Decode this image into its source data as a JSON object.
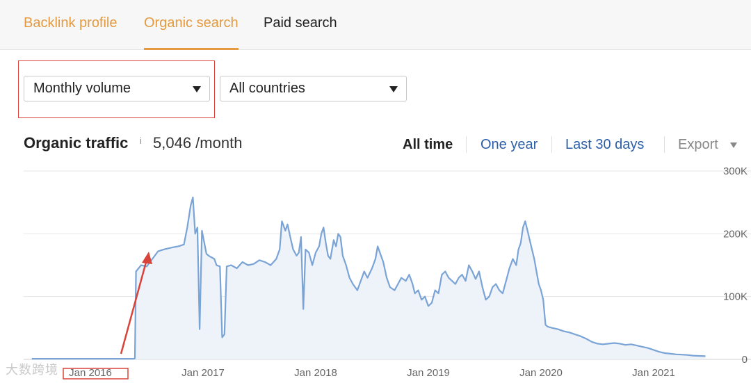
{
  "tabs": [
    {
      "label": "Backlink profile"
    },
    {
      "label": "Organic search"
    },
    {
      "label": "Paid search"
    }
  ],
  "filters": {
    "volume": "Monthly volume",
    "country": "All countries"
  },
  "traffic": {
    "title": "Organic traffic",
    "info": "i",
    "value": "5,046 /month"
  },
  "ranges": {
    "all": "All time",
    "year": "One year",
    "last30": "Last 30 days",
    "export": "Export"
  },
  "watermark": "大数跨境",
  "colors": {
    "accent": "#e39a40",
    "link": "#2c5ea8",
    "line": "#7aa3d6",
    "fill": "#eef3fa",
    "annotation": "#d9443a"
  },
  "chart_data": {
    "type": "area",
    "ylim": [
      0,
      300000
    ],
    "y_ticks": [
      {
        "value": 300000,
        "label": "300K"
      },
      {
        "value": 200000,
        "label": "200K"
      },
      {
        "value": 100000,
        "label": "100K"
      },
      {
        "value": 0,
        "label": "0"
      }
    ],
    "x_ticks": [
      {
        "value": 2016.0,
        "label": "Jan 2016"
      },
      {
        "value": 2017.0,
        "label": "Jan 2017"
      },
      {
        "value": 2018.0,
        "label": "Jan 2018"
      },
      {
        "value": 2019.0,
        "label": "Jan 2019"
      },
      {
        "value": 2020.0,
        "label": "Jan 2020"
      },
      {
        "value": 2021.0,
        "label": "Jan 2021"
      }
    ],
    "series": [
      {
        "points": [
          [
            2015.48,
            1000
          ],
          [
            2016.0,
            1000
          ],
          [
            2016.38,
            1000
          ],
          [
            2016.395,
            1500
          ],
          [
            2016.405,
            140000
          ],
          [
            2016.45,
            150000
          ],
          [
            2016.5,
            148000
          ],
          [
            2016.55,
            160000
          ],
          [
            2016.6,
            172000
          ],
          [
            2016.65,
            175000
          ],
          [
            2016.72,
            178000
          ],
          [
            2016.78,
            180000
          ],
          [
            2016.83,
            183000
          ],
          [
            2016.86,
            210000
          ],
          [
            2016.89,
            245000
          ],
          [
            2016.91,
            258000
          ],
          [
            2016.93,
            200000
          ],
          [
            2016.95,
            210000
          ],
          [
            2016.97,
            48000
          ],
          [
            2016.99,
            205000
          ],
          [
            2017.03,
            168000
          ],
          [
            2017.05,
            165000
          ],
          [
            2017.1,
            160000
          ],
          [
            2017.12,
            150000
          ],
          [
            2017.15,
            148000
          ],
          [
            2017.17,
            35000
          ],
          [
            2017.19,
            40000
          ],
          [
            2017.21,
            148000
          ],
          [
            2017.25,
            150000
          ],
          [
            2017.3,
            145000
          ],
          [
            2017.35,
            155000
          ],
          [
            2017.4,
            150000
          ],
          [
            2017.45,
            152000
          ],
          [
            2017.5,
            158000
          ],
          [
            2017.55,
            155000
          ],
          [
            2017.6,
            150000
          ],
          [
            2017.65,
            160000
          ],
          [
            2017.68,
            175000
          ],
          [
            2017.7,
            220000
          ],
          [
            2017.73,
            205000
          ],
          [
            2017.75,
            215000
          ],
          [
            2017.78,
            190000
          ],
          [
            2017.8,
            175000
          ],
          [
            2017.83,
            165000
          ],
          [
            2017.85,
            170000
          ],
          [
            2017.87,
            195000
          ],
          [
            2017.89,
            80000
          ],
          [
            2017.91,
            175000
          ],
          [
            2017.94,
            170000
          ],
          [
            2017.97,
            150000
          ],
          [
            2018.0,
            170000
          ],
          [
            2018.03,
            180000
          ],
          [
            2018.05,
            200000
          ],
          [
            2018.07,
            210000
          ],
          [
            2018.09,
            185000
          ],
          [
            2018.11,
            165000
          ],
          [
            2018.13,
            160000
          ],
          [
            2018.16,
            190000
          ],
          [
            2018.18,
            180000
          ],
          [
            2018.2,
            200000
          ],
          [
            2018.22,
            195000
          ],
          [
            2018.24,
            165000
          ],
          [
            2018.27,
            150000
          ],
          [
            2018.3,
            130000
          ],
          [
            2018.33,
            120000
          ],
          [
            2018.37,
            110000
          ],
          [
            2018.4,
            125000
          ],
          [
            2018.43,
            140000
          ],
          [
            2018.46,
            130000
          ],
          [
            2018.5,
            145000
          ],
          [
            2018.53,
            160000
          ],
          [
            2018.55,
            180000
          ],
          [
            2018.57,
            170000
          ],
          [
            2018.6,
            155000
          ],
          [
            2018.63,
            130000
          ],
          [
            2018.66,
            115000
          ],
          [
            2018.7,
            110000
          ],
          [
            2018.73,
            120000
          ],
          [
            2018.76,
            130000
          ],
          [
            2018.8,
            125000
          ],
          [
            2018.83,
            135000
          ],
          [
            2018.86,
            120000
          ],
          [
            2018.88,
            105000
          ],
          [
            2018.91,
            110000
          ],
          [
            2018.94,
            95000
          ],
          [
            2018.97,
            100000
          ],
          [
            2019.0,
            85000
          ],
          [
            2019.03,
            90000
          ],
          [
            2019.06,
            110000
          ],
          [
            2019.09,
            105000
          ],
          [
            2019.12,
            135000
          ],
          [
            2019.15,
            140000
          ],
          [
            2019.18,
            130000
          ],
          [
            2019.21,
            125000
          ],
          [
            2019.24,
            120000
          ],
          [
            2019.27,
            130000
          ],
          [
            2019.3,
            135000
          ],
          [
            2019.33,
            125000
          ],
          [
            2019.36,
            150000
          ],
          [
            2019.39,
            140000
          ],
          [
            2019.42,
            128000
          ],
          [
            2019.45,
            140000
          ],
          [
            2019.48,
            115000
          ],
          [
            2019.51,
            95000
          ],
          [
            2019.54,
            100000
          ],
          [
            2019.57,
            115000
          ],
          [
            2019.6,
            120000
          ],
          [
            2019.63,
            110000
          ],
          [
            2019.66,
            105000
          ],
          [
            2019.69,
            125000
          ],
          [
            2019.72,
            145000
          ],
          [
            2019.75,
            160000
          ],
          [
            2019.78,
            150000
          ],
          [
            2019.8,
            175000
          ],
          [
            2019.82,
            185000
          ],
          [
            2019.84,
            210000
          ],
          [
            2019.86,
            220000
          ],
          [
            2019.88,
            205000
          ],
          [
            2019.9,
            190000
          ],
          [
            2019.92,
            175000
          ],
          [
            2019.94,
            160000
          ],
          [
            2019.96,
            140000
          ],
          [
            2019.98,
            120000
          ],
          [
            2020.0,
            110000
          ],
          [
            2020.02,
            95000
          ],
          [
            2020.04,
            55000
          ],
          [
            2020.06,
            52000
          ],
          [
            2020.1,
            50000
          ],
          [
            2020.15,
            48000
          ],
          [
            2020.2,
            45000
          ],
          [
            2020.25,
            43000
          ],
          [
            2020.3,
            40000
          ],
          [
            2020.35,
            37000
          ],
          [
            2020.4,
            33000
          ],
          [
            2020.45,
            28000
          ],
          [
            2020.5,
            25000
          ],
          [
            2020.55,
            24000
          ],
          [
            2020.6,
            25000
          ],
          [
            2020.65,
            26000
          ],
          [
            2020.7,
            25000
          ],
          [
            2020.75,
            23000
          ],
          [
            2020.8,
            24000
          ],
          [
            2020.85,
            22000
          ],
          [
            2020.9,
            20000
          ],
          [
            2020.95,
            18000
          ],
          [
            2021.0,
            15000
          ],
          [
            2021.05,
            12000
          ],
          [
            2021.1,
            10000
          ],
          [
            2021.15,
            9000
          ],
          [
            2021.2,
            8000
          ],
          [
            2021.25,
            7500
          ],
          [
            2021.3,
            7000
          ],
          [
            2021.35,
            6000
          ],
          [
            2021.4,
            5500
          ],
          [
            2021.46,
            5046
          ]
        ]
      }
    ]
  }
}
